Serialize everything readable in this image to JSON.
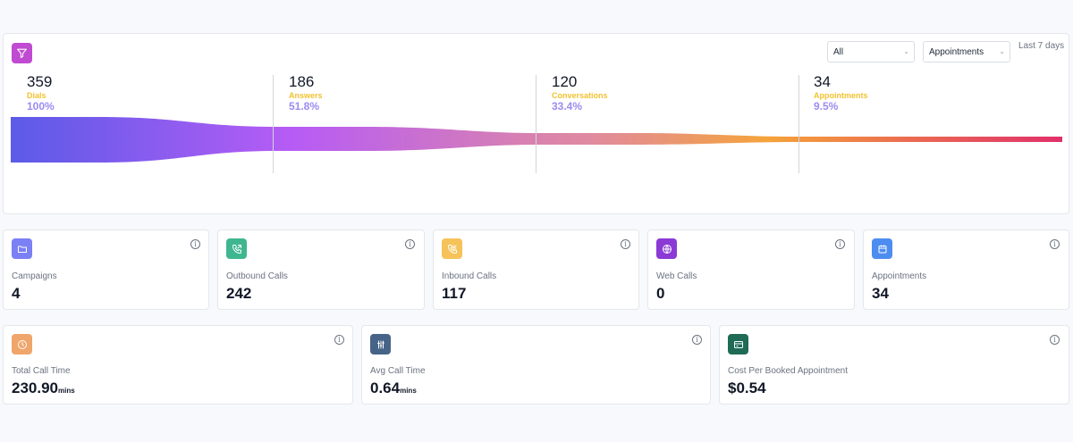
{
  "funnel": {
    "filter_icon": "filter-icon",
    "filter_icon_color": "#c04ad1",
    "select_all": "All",
    "select_type": "Appointments",
    "range_label": "Last 7 days",
    "gradient": [
      "#5b5be8",
      "#b75cf5",
      "#e88f78",
      "#f5a33a",
      "#e0306a"
    ],
    "stages": [
      {
        "count": "359",
        "label": "Dials",
        "percent": "100%"
      },
      {
        "count": "186",
        "label": "Answers",
        "percent": "51.8%"
      },
      {
        "count": "120",
        "label": "Conversations",
        "percent": "33.4%"
      },
      {
        "count": "34",
        "label": "Appointments",
        "percent": "9.5%"
      }
    ]
  },
  "stats_row1": [
    {
      "icon": "folder-icon",
      "color": "#7b80f4",
      "label": "Campaigns",
      "value": "4"
    },
    {
      "icon": "phone-outgoing-icon",
      "color": "#3fb68f",
      "label": "Outbound Calls",
      "value": "242"
    },
    {
      "icon": "phone-incoming-icon",
      "color": "#f6c25a",
      "label": "Inbound Calls",
      "value": "117"
    },
    {
      "icon": "globe-icon",
      "color": "#8b3ad6",
      "label": "Web Calls",
      "value": "0"
    },
    {
      "icon": "calendar-icon",
      "color": "#4d8df0",
      "label": "Appointments",
      "value": "34"
    }
  ],
  "stats_row2": [
    {
      "icon": "clock-icon",
      "color": "#f0a56b",
      "label": "Total Call Time",
      "value": "230.90",
      "unit": "mins"
    },
    {
      "icon": "sliders-icon",
      "color": "#466487",
      "label": "Avg Call Time",
      "value": "0.64",
      "unit": "mins"
    },
    {
      "icon": "credit-card-icon",
      "color": "#1f6b55",
      "label": "Cost Per Booked Appointment",
      "value": "$0.54",
      "unit": ""
    }
  ]
}
